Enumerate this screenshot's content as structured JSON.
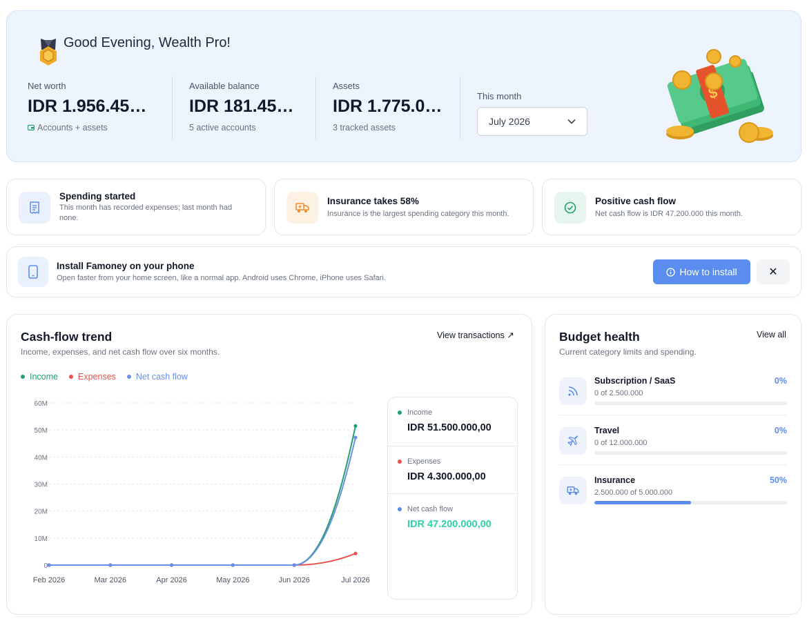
{
  "hero": {
    "greeting": "Good Evening, Wealth Pro!",
    "stats": [
      {
        "label": "Net worth",
        "value": "IDR 1.956.45…",
        "sub": "Accounts + assets"
      },
      {
        "label": "Available balance",
        "value": "IDR 181.452…",
        "sub": "5 active accounts"
      },
      {
        "label": "Assets",
        "value": "IDR 1.775.0…",
        "sub": "3 tracked assets"
      }
    ],
    "month_label": "This month",
    "month_value": "July 2026"
  },
  "insights": [
    {
      "title": "Spending started",
      "desc": "This month has recorded expenses; last month had none.",
      "icon": "receipt-icon",
      "color": "#5b8dee"
    },
    {
      "title": "Insurance takes 58%",
      "desc": "Insurance is the largest spending category this month.",
      "icon": "truck-icon",
      "color": "#f08c2e"
    },
    {
      "title": "Positive cash flow",
      "desc": "Net cash flow is IDR 47.200.000 this month.",
      "icon": "check-circle-icon",
      "color": "#22a06b"
    }
  ],
  "install": {
    "title": "Install Famoney on your phone",
    "desc": "Open faster from your home screen, like a normal app. Android uses Chrome, iPhone uses Safari.",
    "button": "How to install",
    "close": "✕"
  },
  "cashflow": {
    "title": "Cash-flow trend",
    "subtitle": "Income, expenses, and net cash flow over six months.",
    "link": "View transactions ↗",
    "summary": [
      {
        "label": "Income",
        "value": "IDR 51.500.000,00",
        "color": "#22a06b",
        "value_color": "#111827"
      },
      {
        "label": "Expenses",
        "value": "IDR 4.300.000,00",
        "color": "#e5534b",
        "value_color": "#111827"
      },
      {
        "label": "Net cash flow",
        "value": "IDR 47.200.000,00",
        "color": "#5b8dee",
        "value_color": "#2dd4a8"
      }
    ]
  },
  "chart_data": {
    "type": "line",
    "x": [
      "Feb 2026",
      "Mar 2026",
      "Apr 2026",
      "May 2026",
      "Jun 2026",
      "Jul 2026"
    ],
    "series": [
      {
        "name": "Income",
        "values": [
          0,
          0,
          0,
          0,
          0,
          51500000
        ],
        "color": "#22a06b"
      },
      {
        "name": "Expenses",
        "values": [
          0,
          0,
          0,
          0,
          0,
          4300000
        ],
        "color": "#e5534b"
      },
      {
        "name": "Net cash flow",
        "values": [
          0,
          0,
          0,
          0,
          0,
          47200000
        ],
        "color": "#6b8fe8"
      }
    ],
    "y_ticks": [
      "0",
      "10M",
      "20M",
      "30M",
      "40M",
      "50M",
      "60M"
    ],
    "ylim": [
      0,
      60000000
    ],
    "grid": true,
    "legend": "top-left"
  },
  "budget": {
    "title": "Budget health",
    "subtitle": "Current category limits and spending.",
    "link": "View all",
    "items": [
      {
        "name": "Subscription / SaaS",
        "amount": "0 of 2.500.000",
        "pct": "0%",
        "fraction": 0,
        "icon": "rss-icon"
      },
      {
        "name": "Travel",
        "amount": "0 of 12.000.000",
        "pct": "0%",
        "fraction": 0,
        "icon": "plane-icon"
      },
      {
        "name": "Insurance",
        "amount": "2.500.000 of 5.000.000",
        "pct": "50%",
        "fraction": 0.5,
        "icon": "truck-icon"
      }
    ]
  }
}
